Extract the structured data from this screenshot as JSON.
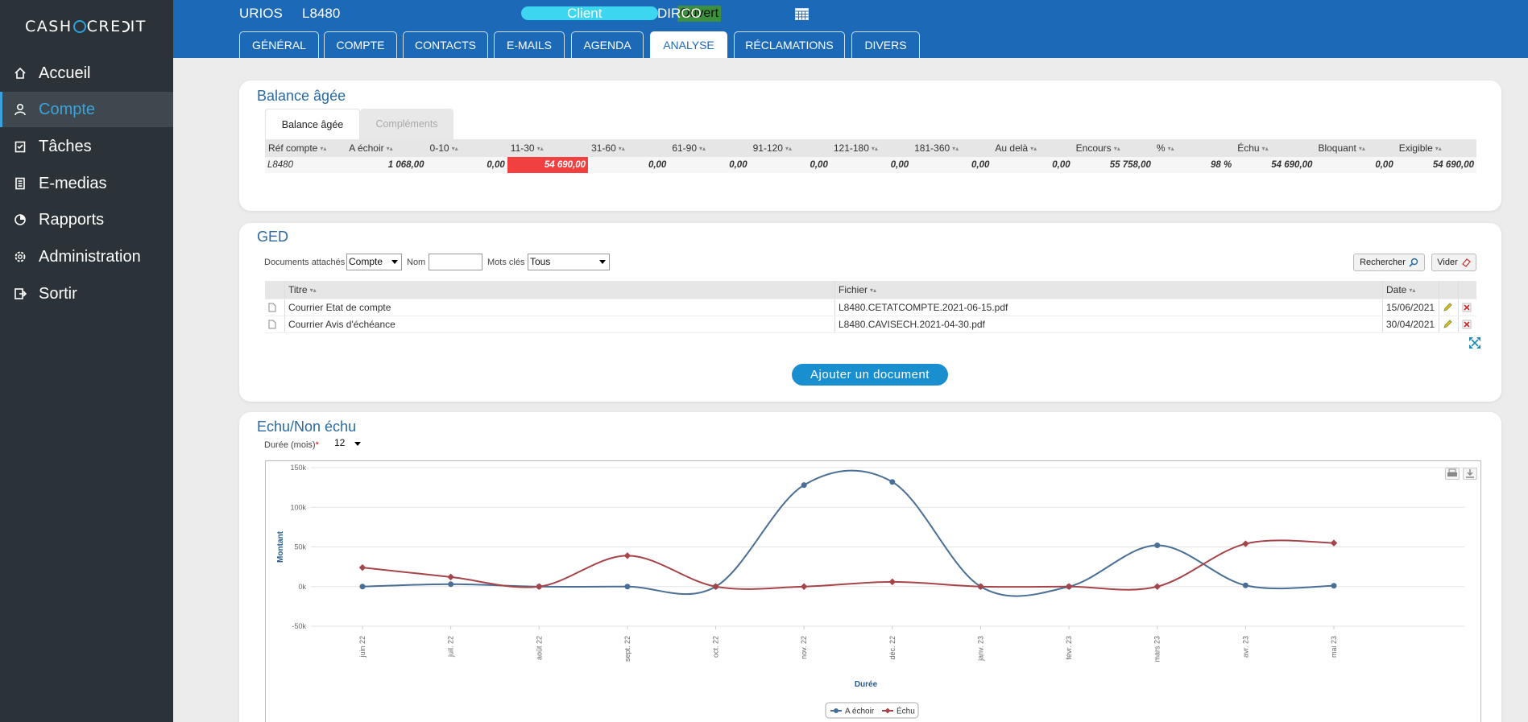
{
  "brand": {
    "logo_left": "CASH",
    "logo_right": "CRE",
    "logo_end": "IT"
  },
  "sidebar": {
    "items": [
      {
        "label": "Accueil",
        "icon": "home-icon",
        "active": false
      },
      {
        "label": "Compte",
        "icon": "user-icon",
        "active": true
      },
      {
        "label": "Tâches",
        "icon": "clipboard-icon",
        "active": false
      },
      {
        "label": "E-medias",
        "icon": "document-icon",
        "active": false
      },
      {
        "label": "Rapports",
        "icon": "chart-icon",
        "active": false
      },
      {
        "label": "Administration",
        "icon": "gear-icon",
        "active": false
      },
      {
        "label": "Sortir",
        "icon": "logout-icon",
        "active": false
      }
    ]
  },
  "header": {
    "client_name": "URIOS",
    "client_code": "L8480",
    "status": "Ouvert",
    "type": "Client",
    "manager": "DIRCO",
    "tabs": [
      "GÉNÉRAL",
      "COMPTE",
      "CONTACTS",
      "E-MAILS",
      "AGENDA",
      "ANALYSE",
      "RÉCLAMATIONS",
      "DIVERS"
    ],
    "active_tab": "ANALYSE"
  },
  "balance": {
    "title": "Balance âgée",
    "tabs": [
      "Balance âgée",
      "Compléments"
    ],
    "columns": [
      "Réf compte",
      "A échoir",
      "0-10",
      "11-30",
      "31-60",
      "61-90",
      "91-120",
      "121-180",
      "181-360",
      "Au delà",
      "Encours",
      "%",
      "Échu",
      "Bloquant",
      "Exigible"
    ],
    "row": [
      "L8480",
      "1 068,00",
      "0,00",
      "54 690,00",
      "0,00",
      "0,00",
      "0,00",
      "0,00",
      "0,00",
      "0,00",
      "55 758,00",
      "98 %",
      "54 690,00",
      "0,00",
      "54 690,00"
    ],
    "highlight_color": "#f04040"
  },
  "ged": {
    "title": "GED",
    "filters": {
      "attached_label": "Documents attachés",
      "attached_value": "Compte",
      "name_label": "Nom",
      "name_value": "",
      "keywords_label": "Mots clés",
      "keywords_value": "Tous"
    },
    "search_button": "Rechercher",
    "clear_button": "Vider",
    "columns": [
      "Titre",
      "Fichier",
      "Date"
    ],
    "rows": [
      {
        "title": "Courrier Etat de compte",
        "file": "L8480.CETATCOMPTE.2021-06-15.pdf",
        "date": "15/06/2021"
      },
      {
        "title": "Courrier Avis d'échéance",
        "file": "L8480.CAVISECH.2021-04-30.pdf",
        "date": "30/04/2021"
      }
    ],
    "add_button": "Ajouter un document"
  },
  "echu": {
    "title": "Echu/Non échu",
    "duration_label": "Durée (mois)",
    "required_mark": "*",
    "duration_value": "12"
  },
  "chart_data": {
    "type": "line",
    "x": [
      "juin 22",
      "juil. 22",
      "août 22",
      "sept. 22",
      "oct. 22",
      "nov. 22",
      "déc. 22",
      "janv. 23",
      "févr. 23",
      "mars 23",
      "avr. 23",
      "mai 23"
    ],
    "series": [
      {
        "name": "A échoir",
        "color": "#4a6f96",
        "values": [
          0,
          3000,
          0,
          0,
          0,
          128000,
          132000,
          0,
          0,
          52000,
          1500,
          1000
        ]
      },
      {
        "name": "Échu",
        "color": "#a5454a",
        "values": [
          24000,
          12000,
          0,
          39000,
          0,
          0,
          6000,
          0,
          0,
          0,
          54000,
          55000
        ]
      }
    ],
    "xlabel": "Durée",
    "ylabel": "Montant",
    "yticks": [
      "-50k",
      "0k",
      "50k",
      "100k",
      "150k"
    ],
    "ylim": [
      -50000,
      150000
    ],
    "grid": true,
    "legend": "bottom-center"
  }
}
